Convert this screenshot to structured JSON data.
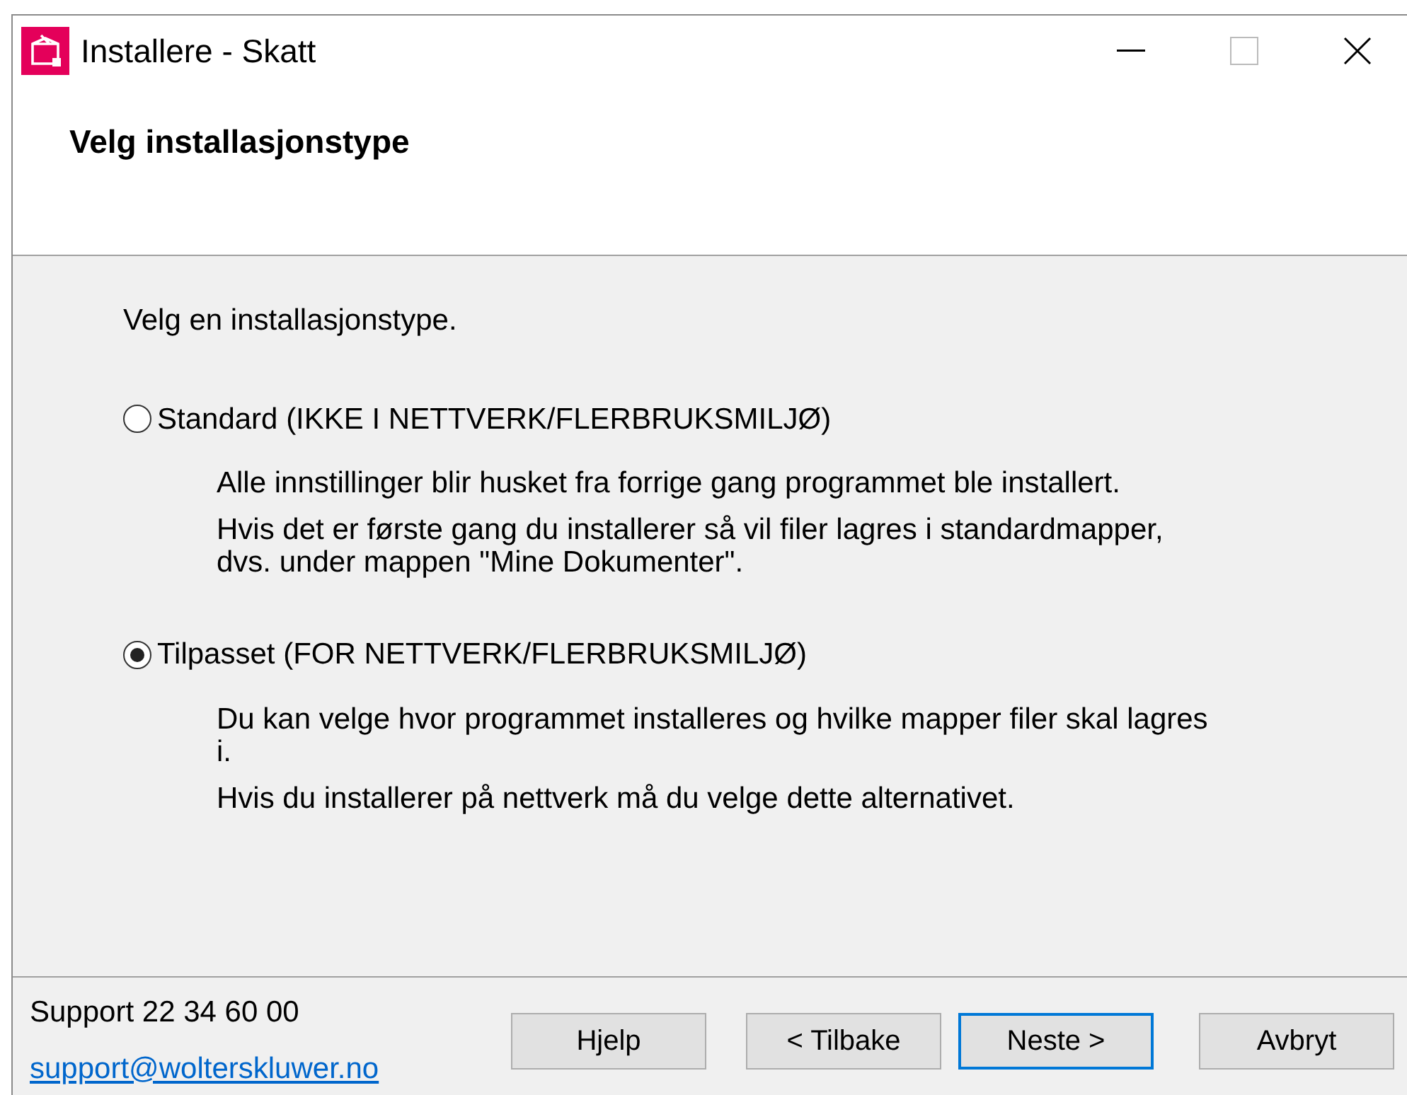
{
  "window": {
    "title": "Installere - Skatt"
  },
  "header": {
    "title": "Velg installasjonstype"
  },
  "intro": "Velg en installasjonstype.",
  "options": [
    {
      "label": "Standard (IKKE I NETTVERK/FLERBRUKSMILJØ)",
      "selected": false,
      "descriptions": [
        "Alle innstillinger blir husket fra forrige gang programmet ble installert.",
        "Hvis det er første gang du installerer så vil filer lagres i standardmapper, dvs. under mappen \"Mine Dokumenter\"."
      ]
    },
    {
      "label": "Tilpasset (FOR NETTVERK/FLERBRUKSMILJØ)",
      "selected": true,
      "descriptions": [
        "Du kan velge hvor programmet installeres og hvilke mapper filer skal lagres i.",
        "Hvis du installerer på nettverk må du velge dette alternativet."
      ]
    }
  ],
  "footer": {
    "support": "Support 22 34 60 00",
    "email": "support@wolterskluwer.no",
    "buttons": [
      {
        "label": "Hjelp",
        "default": false
      },
      {
        "label": "< Tilbake",
        "default": false
      },
      {
        "label": "Neste >",
        "default": true
      },
      {
        "label": "Avbryt",
        "default": false
      }
    ]
  }
}
